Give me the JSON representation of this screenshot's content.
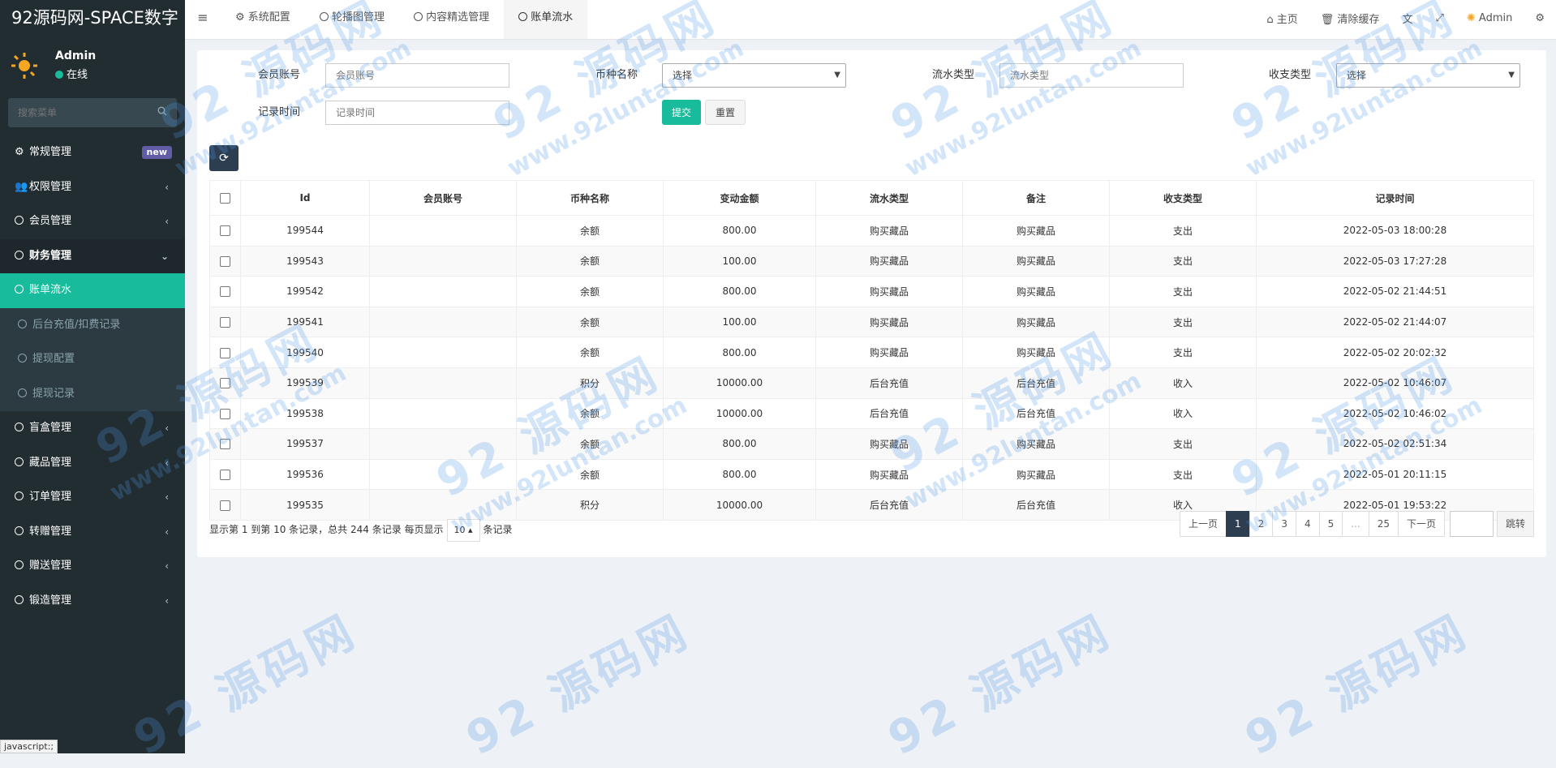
{
  "app": {
    "logo": "92源码网-SPACE数字"
  },
  "user": {
    "name": "Admin",
    "status": "在线"
  },
  "sidebar": {
    "search_placeholder": "搜索菜单",
    "items": [
      {
        "label": "常规管理",
        "badge": "new"
      },
      {
        "label": "权限管理"
      },
      {
        "label": "会员管理"
      },
      {
        "label": "财务管理"
      },
      {
        "label": "账单流水"
      },
      {
        "label": "后台充值/扣费记录"
      },
      {
        "label": "提现配置"
      },
      {
        "label": "提现记录"
      },
      {
        "label": "盲盒管理"
      },
      {
        "label": "藏品管理"
      },
      {
        "label": "订单管理"
      },
      {
        "label": "转赠管理"
      },
      {
        "label": "赠送管理"
      },
      {
        "label": "锻造管理"
      }
    ],
    "status_bar": "javascript:;"
  },
  "tabs": [
    {
      "label": "系统配置"
    },
    {
      "label": "轮播图管理"
    },
    {
      "label": "内容精选管理"
    },
    {
      "label": "账单流水"
    }
  ],
  "topbar": {
    "home": "主页",
    "clear_cache": "清除缓存",
    "admin": "Admin"
  },
  "filters": {
    "member_account": {
      "label": "会员账号",
      "placeholder": "会员账号"
    },
    "currency": {
      "label": "币种名称",
      "value": "选择"
    },
    "flow_type": {
      "label": "流水类型",
      "placeholder": "流水类型"
    },
    "io_type": {
      "label": "收支类型",
      "value": "选择"
    },
    "record_time": {
      "label": "记录时间",
      "placeholder": "记录时间"
    },
    "submit": "提交",
    "reset": "重置"
  },
  "table": {
    "headers": [
      "Id",
      "会员账号",
      "币种名称",
      "变动金额",
      "流水类型",
      "备注",
      "收支类型",
      "记录时间"
    ],
    "rows": [
      {
        "id": "199544",
        "account": "",
        "currency": "余额",
        "amount": "800.00",
        "flow": "购买藏品",
        "remark": "购买藏品",
        "io": "支出",
        "time": "2022-05-03 18:00:28"
      },
      {
        "id": "199543",
        "account": "",
        "currency": "余额",
        "amount": "100.00",
        "flow": "购买藏品",
        "remark": "购买藏品",
        "io": "支出",
        "time": "2022-05-03 17:27:28"
      },
      {
        "id": "199542",
        "account": "",
        "currency": "余额",
        "amount": "800.00",
        "flow": "购买藏品",
        "remark": "购买藏品",
        "io": "支出",
        "time": "2022-05-02 21:44:51"
      },
      {
        "id": "199541",
        "account": "",
        "currency": "余额",
        "amount": "100.00",
        "flow": "购买藏品",
        "remark": "购买藏品",
        "io": "支出",
        "time": "2022-05-02 21:44:07"
      },
      {
        "id": "199540",
        "account": "",
        "currency": "余额",
        "amount": "800.00",
        "flow": "购买藏品",
        "remark": "购买藏品",
        "io": "支出",
        "time": "2022-05-02 20:02:32"
      },
      {
        "id": "199539",
        "account": "",
        "currency": "积分",
        "amount": "10000.00",
        "flow": "后台充值",
        "remark": "后台充值",
        "io": "收入",
        "time": "2022-05-02 10:46:07"
      },
      {
        "id": "199538",
        "account": "",
        "currency": "余额",
        "amount": "10000.00",
        "flow": "后台充值",
        "remark": "后台充值",
        "io": "收入",
        "time": "2022-05-02 10:46:02"
      },
      {
        "id": "199537",
        "account": "",
        "currency": "余额",
        "amount": "800.00",
        "flow": "购买藏品",
        "remark": "购买藏品",
        "io": "支出",
        "time": "2022-05-02 02:51:34"
      },
      {
        "id": "199536",
        "account": "",
        "currency": "余额",
        "amount": "800.00",
        "flow": "购买藏品",
        "remark": "购买藏品",
        "io": "支出",
        "time": "2022-05-01 20:11:15"
      },
      {
        "id": "199535",
        "account": "",
        "currency": "积分",
        "amount": "10000.00",
        "flow": "后台充值",
        "remark": "后台充值",
        "io": "收入",
        "time": "2022-05-01 19:53:22"
      }
    ]
  },
  "pagination": {
    "info_prefix": "显示第 1 到第 10 条记录，总共 244 条记录 每页显示",
    "per_page": "10",
    "info_suffix": "条记录",
    "prev": "上一页",
    "pages": [
      "1",
      "2",
      "3",
      "4",
      "5",
      "...",
      "25"
    ],
    "next": "下一页",
    "jump": "跳转"
  },
  "watermark": {
    "line1": "92 源码网",
    "line2": "www.92luntan.com"
  },
  "colors": {
    "accent": "#18bc9c",
    "sidebar": "#222d32",
    "primary": "#2c3e50"
  }
}
